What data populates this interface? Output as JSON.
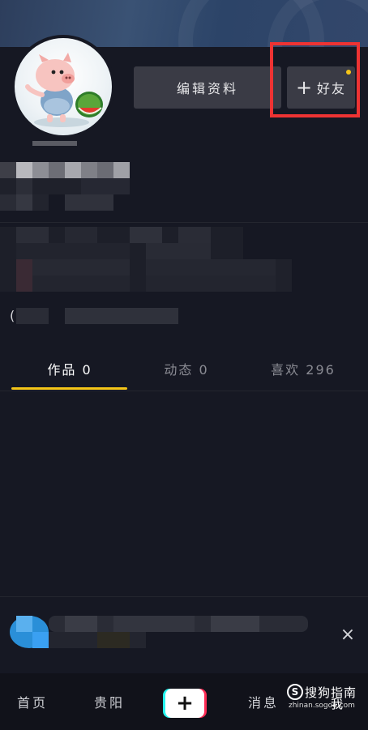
{
  "profile": {
    "edit_button_label": "编辑资料",
    "add_friend_label": "好友",
    "add_friend_plus": "+",
    "bio_paren": "("
  },
  "tabs": [
    {
      "label": "作品 0",
      "active": true
    },
    {
      "label": "动态 0",
      "active": false
    },
    {
      "label": "喜欢 296",
      "active": false
    }
  ],
  "banner": {
    "close_glyph": "×"
  },
  "navbar": {
    "home": "首页",
    "city": "贵阳",
    "add_glyph": "+",
    "messages": "消息",
    "me": "我"
  },
  "watermark": {
    "logo_letter": "S",
    "name": "搜狗指南",
    "url": "zhinan.sogou.com"
  },
  "colors": {
    "background": "#161823",
    "tab_accent": "#f5c518",
    "highlight": "#ee3333",
    "button_bg": "#3a3b45",
    "cyan": "#25f4ee",
    "pink": "#fe2c55"
  }
}
